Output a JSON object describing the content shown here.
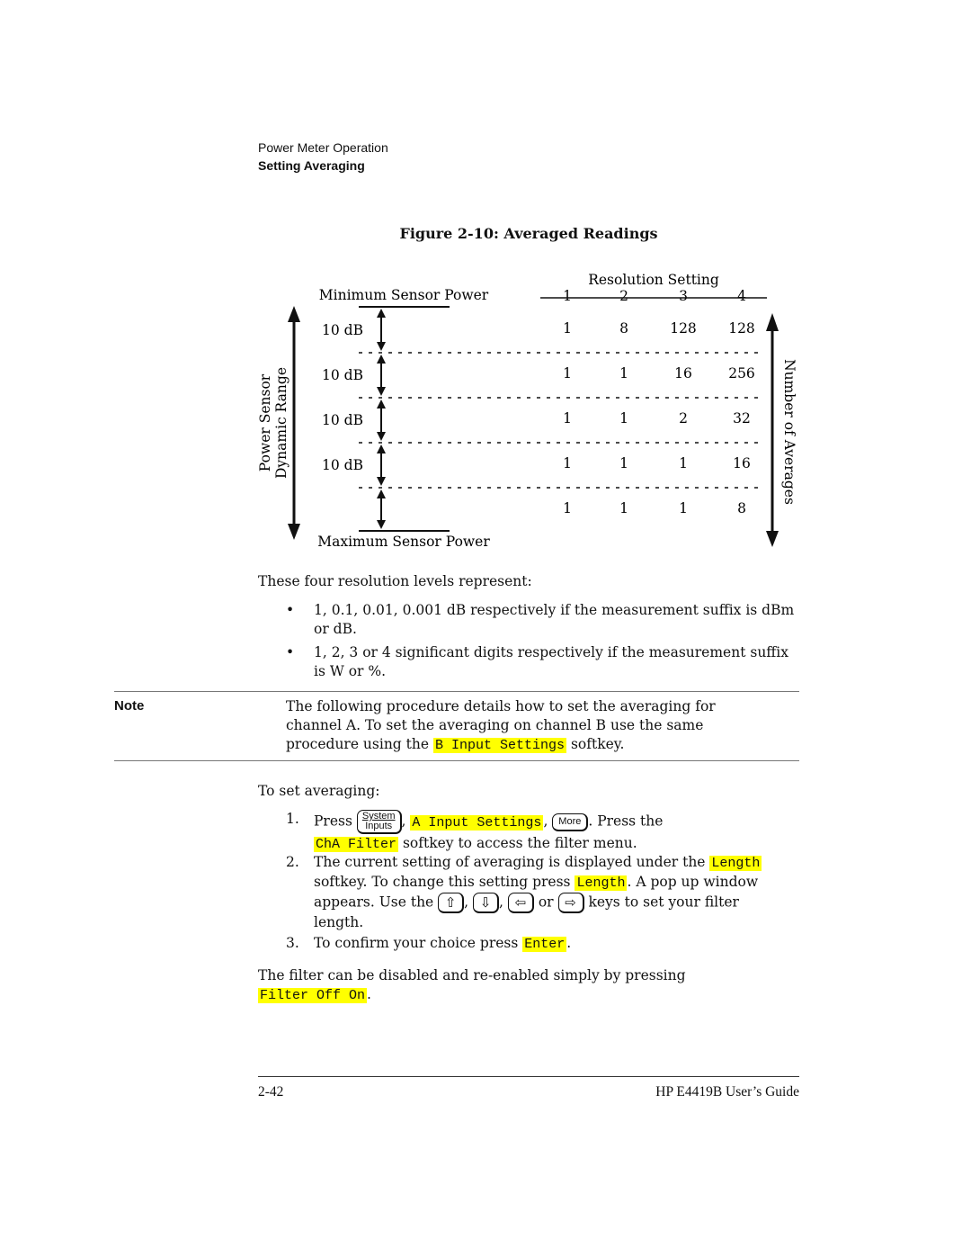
{
  "header": {
    "section": "Power Meter Operation",
    "subsection": "Setting Averaging"
  },
  "figure": {
    "title": "Figure 2-10: Averaged Readings",
    "left_axis_label_line1": "Power Sensor",
    "left_axis_label_line2": "Dynamic Range",
    "top_label": "Minimum Sensor Power",
    "bottom_label": "Maximum Sensor Power",
    "right_axis_label": "Number of Averages",
    "column_header": "Resolution Setting",
    "columns": [
      "1",
      "2",
      "3",
      "4"
    ],
    "band_labels": [
      "10 dB",
      "10 dB",
      "10 dB",
      "10 dB"
    ],
    "rows": [
      [
        "1",
        "8",
        "128",
        "128"
      ],
      [
        "1",
        "1",
        "16",
        "256"
      ],
      [
        "1",
        "1",
        "2",
        "32"
      ],
      [
        "1",
        "1",
        "1",
        "16"
      ],
      [
        "1",
        "1",
        "1",
        "8"
      ]
    ]
  },
  "intro": "These four resolution levels represent:",
  "bullets": [
    "1, 0.1, 0.01, 0.001 dB respectively if the measurement suffix is dBm or dB.",
    "1, 2, 3 or 4 significant digits respectively if the measurement suffix is W or %."
  ],
  "note": {
    "label": "Note",
    "text_before": "The following procedure details how to set the averaging for channel A. To set the averaging on channel B use the same procedure using the",
    "softkey": "B Input Settings",
    "text_after": "softkey."
  },
  "procedure": {
    "lead": "To set averaging:",
    "step1": {
      "num": "1.",
      "press": "Press",
      "key_system_top": "System",
      "key_system_bottom": "Inputs",
      "softkey_a_input": "A Input Settings",
      "key_more": "More",
      "press_the": ". Press the",
      "softkey_filter": "ChA Filter",
      "tail": "softkey to access the filter menu."
    },
    "step2": {
      "num": "2.",
      "t1": "The current setting of averaging is displayed under the",
      "softkey_length1": "Length",
      "t2": "softkey. To change this setting press",
      "softkey_length2": "Length",
      "t3": ". A pop up window appears. Use the",
      "key_up": "⇧",
      "key_down": "⇩",
      "key_left": "⇦",
      "key_right": "⇨",
      "or": "or",
      "t4": "keys to set your filter length."
    },
    "step3": {
      "num": "3.",
      "t1": "To confirm your choice press",
      "softkey_enter": "Enter",
      "t2": "."
    }
  },
  "closing": {
    "text": "The filter can be disabled and re-enabled simply by pressing",
    "softkey": "Filter Off On"
  },
  "footer": {
    "page": "2-42",
    "guide": "HP E4419B User’s Guide"
  }
}
